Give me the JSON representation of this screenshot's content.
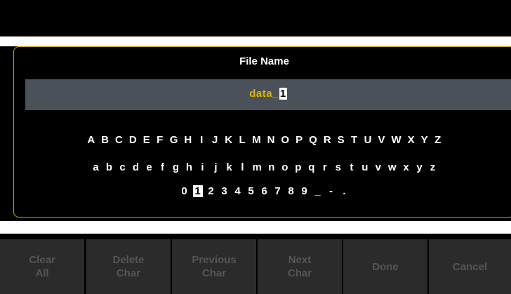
{
  "dialog": {
    "title": "File Name",
    "filename": {
      "text": "data_",
      "cursor_char": "1"
    }
  },
  "keyboard": {
    "upper": [
      "A",
      "B",
      "C",
      "D",
      "E",
      "F",
      "G",
      "H",
      "I",
      "J",
      "K",
      "L",
      "M",
      "N",
      "O",
      "P",
      "Q",
      "R",
      "S",
      "T",
      "U",
      "V",
      "W",
      "X",
      "Y",
      "Z"
    ],
    "lower": [
      "a",
      "b",
      "c",
      "d",
      "e",
      "f",
      "g",
      "h",
      "i",
      "j",
      "k",
      "l",
      "m",
      "n",
      "o",
      "p",
      "q",
      "r",
      "s",
      "t",
      "u",
      "v",
      "w",
      "x",
      "y",
      "z"
    ],
    "digits": [
      "0",
      "1",
      "2",
      "3",
      "4",
      "5",
      "6",
      "7",
      "8",
      "9",
      "_",
      "-",
      "."
    ],
    "selected_key": "1"
  },
  "softkeys": [
    {
      "line1": "Clear",
      "line2": "All",
      "name": "clear-all-button"
    },
    {
      "line1": "Delete",
      "line2": "Char",
      "name": "delete-char-button"
    },
    {
      "line1": "Previous",
      "line2": "Char",
      "name": "previous-char-button"
    },
    {
      "line1": "Next",
      "line2": "Char",
      "name": "next-char-button"
    },
    {
      "line1": "Done",
      "line2": "",
      "name": "done-button"
    },
    {
      "line1": "Cancel",
      "line2": "",
      "name": "cancel-button"
    }
  ],
  "colors": {
    "accent": "#c8a300",
    "filename_text": "#e0b400",
    "name_box": "#4a5158",
    "softkey_bg": "#2b2b2b",
    "softkey_text_disabled": "#555555"
  }
}
